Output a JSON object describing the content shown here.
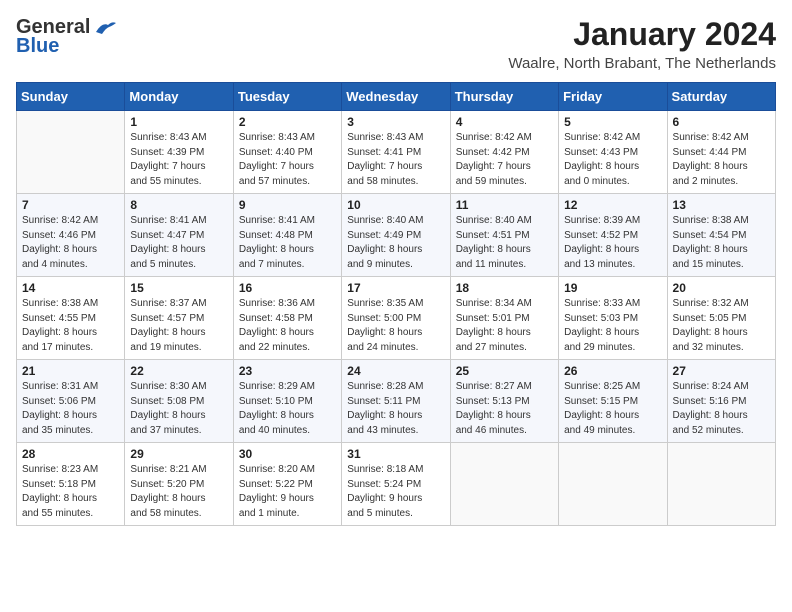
{
  "header": {
    "logo_line1": "General",
    "logo_line2": "Blue",
    "month": "January 2024",
    "location": "Waalre, North Brabant, The Netherlands"
  },
  "weekdays": [
    "Sunday",
    "Monday",
    "Tuesday",
    "Wednesday",
    "Thursday",
    "Friday",
    "Saturday"
  ],
  "weeks": [
    [
      {
        "day": "",
        "info": ""
      },
      {
        "day": "1",
        "info": "Sunrise: 8:43 AM\nSunset: 4:39 PM\nDaylight: 7 hours\nand 55 minutes."
      },
      {
        "day": "2",
        "info": "Sunrise: 8:43 AM\nSunset: 4:40 PM\nDaylight: 7 hours\nand 57 minutes."
      },
      {
        "day": "3",
        "info": "Sunrise: 8:43 AM\nSunset: 4:41 PM\nDaylight: 7 hours\nand 58 minutes."
      },
      {
        "day": "4",
        "info": "Sunrise: 8:42 AM\nSunset: 4:42 PM\nDaylight: 7 hours\nand 59 minutes."
      },
      {
        "day": "5",
        "info": "Sunrise: 8:42 AM\nSunset: 4:43 PM\nDaylight: 8 hours\nand 0 minutes."
      },
      {
        "day": "6",
        "info": "Sunrise: 8:42 AM\nSunset: 4:44 PM\nDaylight: 8 hours\nand 2 minutes."
      }
    ],
    [
      {
        "day": "7",
        "info": "Sunrise: 8:42 AM\nSunset: 4:46 PM\nDaylight: 8 hours\nand 4 minutes."
      },
      {
        "day": "8",
        "info": "Sunrise: 8:41 AM\nSunset: 4:47 PM\nDaylight: 8 hours\nand 5 minutes."
      },
      {
        "day": "9",
        "info": "Sunrise: 8:41 AM\nSunset: 4:48 PM\nDaylight: 8 hours\nand 7 minutes."
      },
      {
        "day": "10",
        "info": "Sunrise: 8:40 AM\nSunset: 4:49 PM\nDaylight: 8 hours\nand 9 minutes."
      },
      {
        "day": "11",
        "info": "Sunrise: 8:40 AM\nSunset: 4:51 PM\nDaylight: 8 hours\nand 11 minutes."
      },
      {
        "day": "12",
        "info": "Sunrise: 8:39 AM\nSunset: 4:52 PM\nDaylight: 8 hours\nand 13 minutes."
      },
      {
        "day": "13",
        "info": "Sunrise: 8:38 AM\nSunset: 4:54 PM\nDaylight: 8 hours\nand 15 minutes."
      }
    ],
    [
      {
        "day": "14",
        "info": "Sunrise: 8:38 AM\nSunset: 4:55 PM\nDaylight: 8 hours\nand 17 minutes."
      },
      {
        "day": "15",
        "info": "Sunrise: 8:37 AM\nSunset: 4:57 PM\nDaylight: 8 hours\nand 19 minutes."
      },
      {
        "day": "16",
        "info": "Sunrise: 8:36 AM\nSunset: 4:58 PM\nDaylight: 8 hours\nand 22 minutes."
      },
      {
        "day": "17",
        "info": "Sunrise: 8:35 AM\nSunset: 5:00 PM\nDaylight: 8 hours\nand 24 minutes."
      },
      {
        "day": "18",
        "info": "Sunrise: 8:34 AM\nSunset: 5:01 PM\nDaylight: 8 hours\nand 27 minutes."
      },
      {
        "day": "19",
        "info": "Sunrise: 8:33 AM\nSunset: 5:03 PM\nDaylight: 8 hours\nand 29 minutes."
      },
      {
        "day": "20",
        "info": "Sunrise: 8:32 AM\nSunset: 5:05 PM\nDaylight: 8 hours\nand 32 minutes."
      }
    ],
    [
      {
        "day": "21",
        "info": "Sunrise: 8:31 AM\nSunset: 5:06 PM\nDaylight: 8 hours\nand 35 minutes."
      },
      {
        "day": "22",
        "info": "Sunrise: 8:30 AM\nSunset: 5:08 PM\nDaylight: 8 hours\nand 37 minutes."
      },
      {
        "day": "23",
        "info": "Sunrise: 8:29 AM\nSunset: 5:10 PM\nDaylight: 8 hours\nand 40 minutes."
      },
      {
        "day": "24",
        "info": "Sunrise: 8:28 AM\nSunset: 5:11 PM\nDaylight: 8 hours\nand 43 minutes."
      },
      {
        "day": "25",
        "info": "Sunrise: 8:27 AM\nSunset: 5:13 PM\nDaylight: 8 hours\nand 46 minutes."
      },
      {
        "day": "26",
        "info": "Sunrise: 8:25 AM\nSunset: 5:15 PM\nDaylight: 8 hours\nand 49 minutes."
      },
      {
        "day": "27",
        "info": "Sunrise: 8:24 AM\nSunset: 5:16 PM\nDaylight: 8 hours\nand 52 minutes."
      }
    ],
    [
      {
        "day": "28",
        "info": "Sunrise: 8:23 AM\nSunset: 5:18 PM\nDaylight: 8 hours\nand 55 minutes."
      },
      {
        "day": "29",
        "info": "Sunrise: 8:21 AM\nSunset: 5:20 PM\nDaylight: 8 hours\nand 58 minutes."
      },
      {
        "day": "30",
        "info": "Sunrise: 8:20 AM\nSunset: 5:22 PM\nDaylight: 9 hours\nand 1 minute."
      },
      {
        "day": "31",
        "info": "Sunrise: 8:18 AM\nSunset: 5:24 PM\nDaylight: 9 hours\nand 5 minutes."
      },
      {
        "day": "",
        "info": ""
      },
      {
        "day": "",
        "info": ""
      },
      {
        "day": "",
        "info": ""
      }
    ]
  ]
}
